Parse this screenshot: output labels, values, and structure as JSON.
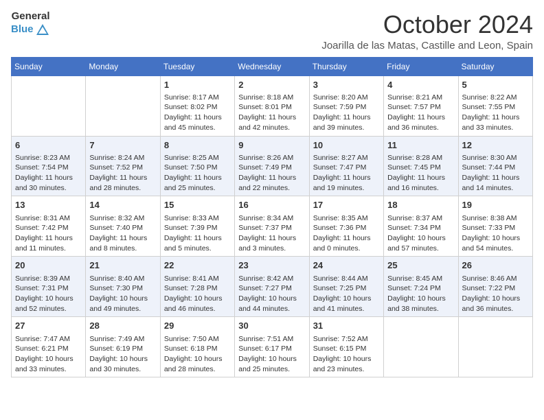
{
  "header": {
    "logo_general": "General",
    "logo_blue": "Blue",
    "month_title": "October 2024",
    "location": "Joarilla de las Matas, Castille and Leon, Spain"
  },
  "days_of_week": [
    "Sunday",
    "Monday",
    "Tuesday",
    "Wednesday",
    "Thursday",
    "Friday",
    "Saturday"
  ],
  "weeks": [
    [
      {
        "day": "",
        "content": ""
      },
      {
        "day": "",
        "content": ""
      },
      {
        "day": "1",
        "content": "Sunrise: 8:17 AM\nSunset: 8:02 PM\nDaylight: 11 hours and 45 minutes."
      },
      {
        "day": "2",
        "content": "Sunrise: 8:18 AM\nSunset: 8:01 PM\nDaylight: 11 hours and 42 minutes."
      },
      {
        "day": "3",
        "content": "Sunrise: 8:20 AM\nSunset: 7:59 PM\nDaylight: 11 hours and 39 minutes."
      },
      {
        "day": "4",
        "content": "Sunrise: 8:21 AM\nSunset: 7:57 PM\nDaylight: 11 hours and 36 minutes."
      },
      {
        "day": "5",
        "content": "Sunrise: 8:22 AM\nSunset: 7:55 PM\nDaylight: 11 hours and 33 minutes."
      }
    ],
    [
      {
        "day": "6",
        "content": "Sunrise: 8:23 AM\nSunset: 7:54 PM\nDaylight: 11 hours and 30 minutes."
      },
      {
        "day": "7",
        "content": "Sunrise: 8:24 AM\nSunset: 7:52 PM\nDaylight: 11 hours and 28 minutes."
      },
      {
        "day": "8",
        "content": "Sunrise: 8:25 AM\nSunset: 7:50 PM\nDaylight: 11 hours and 25 minutes."
      },
      {
        "day": "9",
        "content": "Sunrise: 8:26 AM\nSunset: 7:49 PM\nDaylight: 11 hours and 22 minutes."
      },
      {
        "day": "10",
        "content": "Sunrise: 8:27 AM\nSunset: 7:47 PM\nDaylight: 11 hours and 19 minutes."
      },
      {
        "day": "11",
        "content": "Sunrise: 8:28 AM\nSunset: 7:45 PM\nDaylight: 11 hours and 16 minutes."
      },
      {
        "day": "12",
        "content": "Sunrise: 8:30 AM\nSunset: 7:44 PM\nDaylight: 11 hours and 14 minutes."
      }
    ],
    [
      {
        "day": "13",
        "content": "Sunrise: 8:31 AM\nSunset: 7:42 PM\nDaylight: 11 hours and 11 minutes."
      },
      {
        "day": "14",
        "content": "Sunrise: 8:32 AM\nSunset: 7:40 PM\nDaylight: 11 hours and 8 minutes."
      },
      {
        "day": "15",
        "content": "Sunrise: 8:33 AM\nSunset: 7:39 PM\nDaylight: 11 hours and 5 minutes."
      },
      {
        "day": "16",
        "content": "Sunrise: 8:34 AM\nSunset: 7:37 PM\nDaylight: 11 hours and 3 minutes."
      },
      {
        "day": "17",
        "content": "Sunrise: 8:35 AM\nSunset: 7:36 PM\nDaylight: 11 hours and 0 minutes."
      },
      {
        "day": "18",
        "content": "Sunrise: 8:37 AM\nSunset: 7:34 PM\nDaylight: 10 hours and 57 minutes."
      },
      {
        "day": "19",
        "content": "Sunrise: 8:38 AM\nSunset: 7:33 PM\nDaylight: 10 hours and 54 minutes."
      }
    ],
    [
      {
        "day": "20",
        "content": "Sunrise: 8:39 AM\nSunset: 7:31 PM\nDaylight: 10 hours and 52 minutes."
      },
      {
        "day": "21",
        "content": "Sunrise: 8:40 AM\nSunset: 7:30 PM\nDaylight: 10 hours and 49 minutes."
      },
      {
        "day": "22",
        "content": "Sunrise: 8:41 AM\nSunset: 7:28 PM\nDaylight: 10 hours and 46 minutes."
      },
      {
        "day": "23",
        "content": "Sunrise: 8:42 AM\nSunset: 7:27 PM\nDaylight: 10 hours and 44 minutes."
      },
      {
        "day": "24",
        "content": "Sunrise: 8:44 AM\nSunset: 7:25 PM\nDaylight: 10 hours and 41 minutes."
      },
      {
        "day": "25",
        "content": "Sunrise: 8:45 AM\nSunset: 7:24 PM\nDaylight: 10 hours and 38 minutes."
      },
      {
        "day": "26",
        "content": "Sunrise: 8:46 AM\nSunset: 7:22 PM\nDaylight: 10 hours and 36 minutes."
      }
    ],
    [
      {
        "day": "27",
        "content": "Sunrise: 7:47 AM\nSunset: 6:21 PM\nDaylight: 10 hours and 33 minutes."
      },
      {
        "day": "28",
        "content": "Sunrise: 7:49 AM\nSunset: 6:19 PM\nDaylight: 10 hours and 30 minutes."
      },
      {
        "day": "29",
        "content": "Sunrise: 7:50 AM\nSunset: 6:18 PM\nDaylight: 10 hours and 28 minutes."
      },
      {
        "day": "30",
        "content": "Sunrise: 7:51 AM\nSunset: 6:17 PM\nDaylight: 10 hours and 25 minutes."
      },
      {
        "day": "31",
        "content": "Sunrise: 7:52 AM\nSunset: 6:15 PM\nDaylight: 10 hours and 23 minutes."
      },
      {
        "day": "",
        "content": ""
      },
      {
        "day": "",
        "content": ""
      }
    ]
  ]
}
